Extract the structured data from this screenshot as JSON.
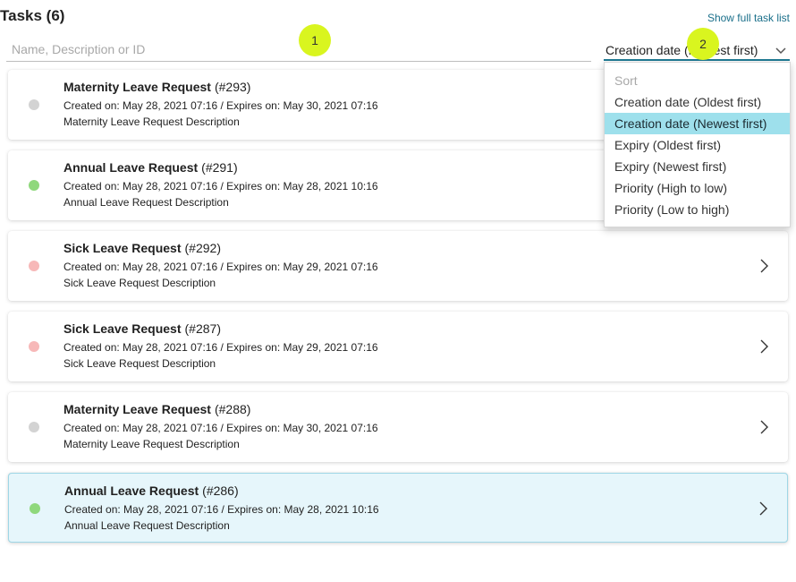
{
  "header": {
    "title": "Tasks (6)",
    "full_list_link": "Show full task list"
  },
  "search": {
    "placeholder": "Name, Description or ID",
    "value": ""
  },
  "sort": {
    "selected": "Creation date (Newest first)",
    "options": [
      {
        "label": "Sort",
        "type": "header"
      },
      {
        "label": "Creation date (Oldest first)",
        "type": "option"
      },
      {
        "label": "Creation date (Newest first)",
        "type": "option",
        "active": true
      },
      {
        "label": "Expiry (Oldest first)",
        "type": "option"
      },
      {
        "label": "Expiry (Newest first)",
        "type": "option"
      },
      {
        "label": "Priority (High to low)",
        "type": "option"
      },
      {
        "label": "Priority (Low to high)",
        "type": "option"
      }
    ]
  },
  "tasks": [
    {
      "name": "Maternity Leave Request",
      "id": "(#293)",
      "meta": "Created on: May 28, 2021 07:16 / Expires on: May 30, 2021 07:16",
      "description": "Maternity Leave Request Description",
      "status": "grey",
      "selected": false
    },
    {
      "name": "Annual Leave Request",
      "id": "(#291)",
      "meta": "Created on: May 28, 2021 07:16 / Expires on: May 28, 2021 10:16",
      "description": "Annual Leave Request Description",
      "status": "green",
      "selected": false
    },
    {
      "name": "Sick Leave Request",
      "id": "(#292)",
      "meta": "Created on: May 28, 2021 07:16 / Expires on: May 29, 2021 07:16",
      "description": "Sick Leave Request Description",
      "status": "pink",
      "selected": false
    },
    {
      "name": "Sick Leave Request",
      "id": "(#287)",
      "meta": "Created on: May 28, 2021 07:16 / Expires on: May 29, 2021 07:16",
      "description": "Sick Leave Request Description",
      "status": "pink",
      "selected": false
    },
    {
      "name": "Maternity Leave Request",
      "id": "(#288)",
      "meta": "Created on: May 28, 2021 07:16 / Expires on: May 30, 2021 07:16",
      "description": "Maternity Leave Request Description",
      "status": "grey",
      "selected": false
    },
    {
      "name": "Annual Leave Request",
      "id": "(#286)",
      "meta": "Created on: May 28, 2021 07:16 / Expires on: May 28, 2021 10:16",
      "description": "Annual Leave Request Description",
      "status": "green",
      "selected": true
    }
  ],
  "annotations": [
    "1",
    "2"
  ],
  "colors": {
    "accent": "#1f7a94",
    "selected_row": "#e6f6fb",
    "active_option": "#9ee0ec",
    "badge": "#d9f51f",
    "status_grey": "#d3d3d3",
    "status_green": "#8fd87c",
    "status_pink": "#f7b8b8"
  }
}
